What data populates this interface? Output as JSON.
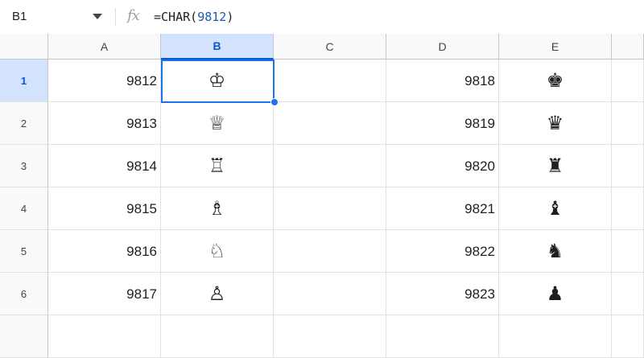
{
  "formula_bar": {
    "name_box": "B1",
    "fx_label": "fx",
    "formula_prefix": "=CHAR(",
    "formula_arg": "9812",
    "formula_suffix": ")"
  },
  "columns": [
    "A",
    "B",
    "C",
    "D",
    "E"
  ],
  "selected_column": "B",
  "rows": [
    {
      "label": "1",
      "a": "9812",
      "b": "♔",
      "c": "",
      "d": "9818",
      "e": "♚"
    },
    {
      "label": "2",
      "a": "9813",
      "b": "♕",
      "c": "",
      "d": "9819",
      "e": "♛"
    },
    {
      "label": "3",
      "a": "9814",
      "b": "♖",
      "c": "",
      "d": "9820",
      "e": "♜"
    },
    {
      "label": "4",
      "a": "9815",
      "b": "♗",
      "c": "",
      "d": "9821",
      "e": "♝"
    },
    {
      "label": "5",
      "a": "9816",
      "b": "♘",
      "c": "",
      "d": "9822",
      "e": "♞"
    },
    {
      "label": "6",
      "a": "9817",
      "b": "♙",
      "c": "",
      "d": "9823",
      "e": "♟"
    }
  ],
  "selected_row": "1",
  "colors": {
    "selection": "#1a73e8",
    "header_selected_bg": "#d3e3fd",
    "formula_number": "#1a5aa8"
  }
}
